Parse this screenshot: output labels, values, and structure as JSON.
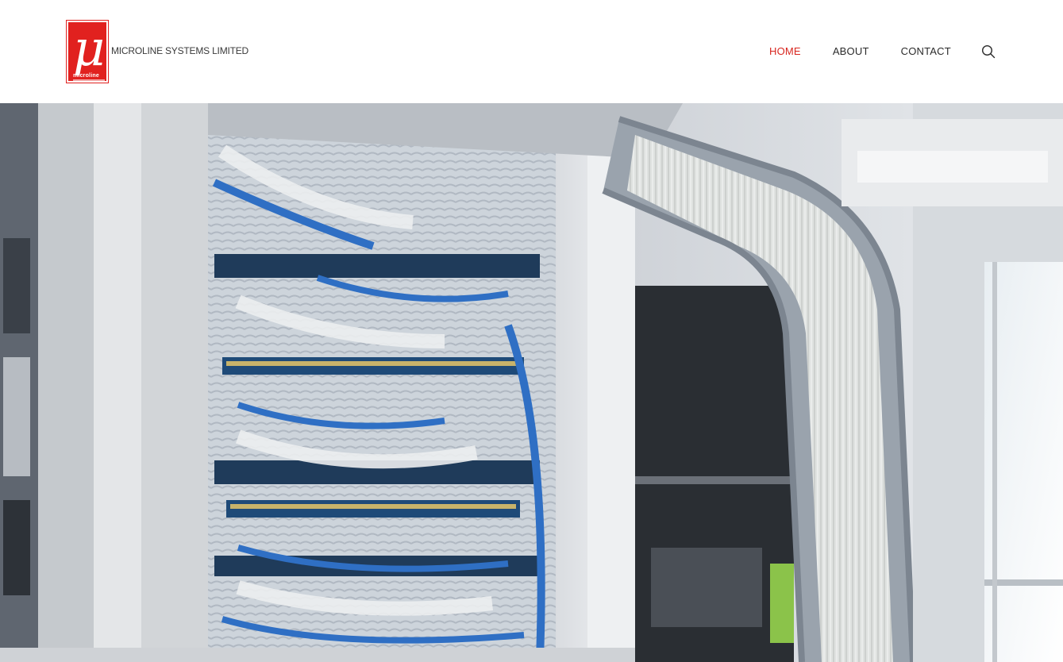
{
  "brand": {
    "logo_glyph": "μ",
    "logo_small_text": "microline",
    "name": "MICROLINE SYSTEMS LIMITED",
    "accent_color": "#e1211f"
  },
  "nav": {
    "items": [
      {
        "label": "HOME",
        "active": true
      },
      {
        "label": "ABOUT",
        "active": false
      },
      {
        "label": "CONTACT",
        "active": false
      }
    ],
    "active_color": "#d8261f",
    "search_icon": "search-icon"
  },
  "hero": {
    "image_subject": "server-rack-photo"
  }
}
